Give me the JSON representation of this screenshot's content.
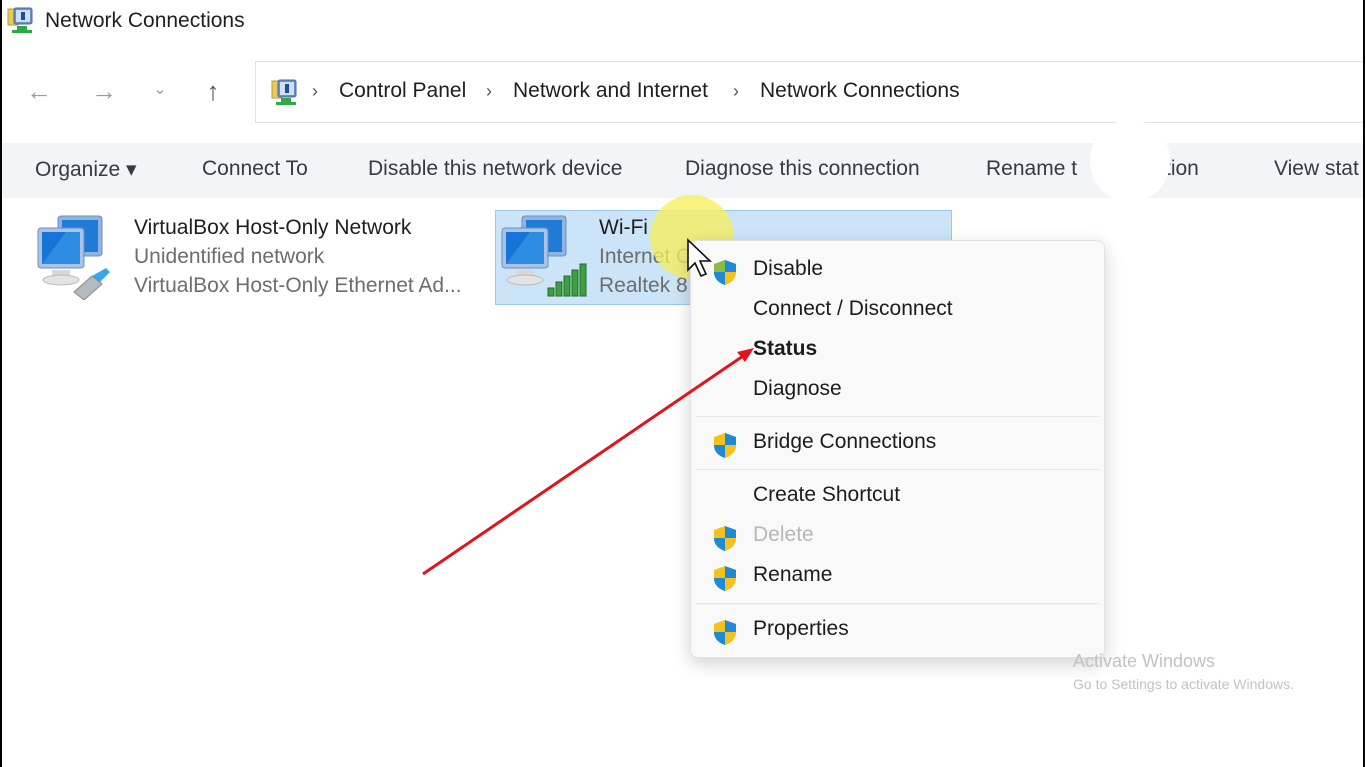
{
  "window": {
    "title": "Network Connections",
    "title_icon": "network-connections-icon"
  },
  "nav": {
    "back": "←",
    "forward": "→",
    "recent": "⌄",
    "up": "↑"
  },
  "address_bar": {
    "separator": "›",
    "crumbs": [
      "Control Panel",
      "Network and Internet",
      "Network Connections"
    ]
  },
  "command_bar": {
    "items": [
      {
        "label": "Organize ▾"
      },
      {
        "label": "Connect To"
      },
      {
        "label": "Disable this network device"
      },
      {
        "label": "Diagnose this connection"
      },
      {
        "label": "Rename t"
      },
      {
        "label": "tion"
      },
      {
        "label": "View stat"
      }
    ]
  },
  "connections": [
    {
      "name": "VirtualBox Host-Only Network",
      "status": "Unidentified network",
      "adapter": "VirtualBox Host-Only Ethernet Ad...",
      "type": "ethernet",
      "selected": false
    },
    {
      "name": "Wi-Fi",
      "status": "Internet C",
      "adapter": "Realtek 8",
      "type": "wifi",
      "selected": true
    }
  ],
  "context_menu": {
    "items": [
      {
        "label": "Disable",
        "shield": true,
        "bold": false,
        "disabled": false
      },
      {
        "label": "Connect / Disconnect",
        "shield": false,
        "bold": false,
        "disabled": false
      },
      {
        "label": "Status",
        "shield": false,
        "bold": true,
        "disabled": false
      },
      {
        "label": "Diagnose",
        "shield": false,
        "bold": false,
        "disabled": false
      },
      {
        "label": "Bridge Connections",
        "shield": true,
        "bold": false,
        "disabled": false
      },
      {
        "label": "Create Shortcut",
        "shield": false,
        "bold": false,
        "disabled": false
      },
      {
        "label": "Delete",
        "shield": true,
        "bold": false,
        "disabled": true
      },
      {
        "label": "Rename",
        "shield": true,
        "bold": false,
        "disabled": false
      },
      {
        "label": "Properties",
        "shield": true,
        "bold": false,
        "disabled": false
      }
    ]
  },
  "watermark": {
    "title": "Activate Windows",
    "subtitle": "Go to Settings to activate Windows."
  },
  "colors": {
    "selection_bg": "#cce4f7",
    "annotation_arrow": "#e0141e",
    "cursor_halo": "#f6ee5c"
  }
}
